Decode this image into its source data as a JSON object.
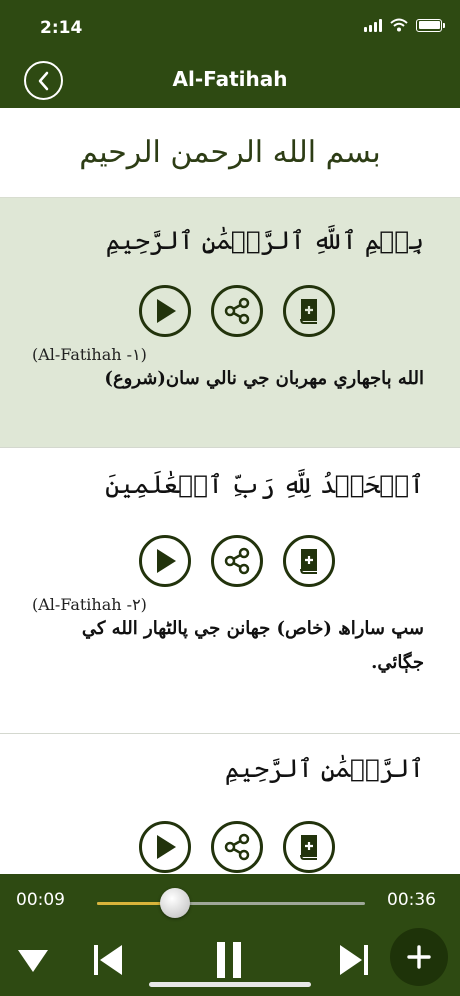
{
  "status": {
    "time": "2:14"
  },
  "header": {
    "title": "Al-Fatihah"
  },
  "bismillah_banner": {
    "text": "بسم الله الرحمن الرحيم"
  },
  "verses": [
    {
      "arabic": "بِسۡمِ ٱللَّهِ ٱلرَّحۡمَٰنِ ٱلرَّحِيمِ",
      "reference": "(Al-Fatihah -١)",
      "translation": "الله ٻاجھاري مھربان جي نالي سان(شروع)",
      "highlighted": true
    },
    {
      "arabic": "ٱلۡحَمۡدُ لِلَّهِ رَبِّ ٱلۡعَٰلَمِينَ",
      "reference": "(Al-Fatihah -٢)",
      "translation_line1": "سڀ ساراھ (خاص) جھانن جي پالڻھار الله کي",
      "translation_line2": "جڳائي.",
      "highlighted": false
    },
    {
      "arabic": "ٱلرَّحۡمَٰنِ ٱلرَّحِيمِ",
      "highlighted": false
    }
  ],
  "player": {
    "current_time": "00:09",
    "total_time": "00:36",
    "progress": 0.29,
    "accent_color": "#d9b43b"
  },
  "icons": [
    "back-chevron-icon",
    "play-icon",
    "share-icon",
    "quran-book-icon",
    "down-arrow-icon",
    "previous-icon",
    "pause-icon",
    "next-icon",
    "plus-icon"
  ],
  "colors": {
    "header_bg": "#2e4a12",
    "highlight_bg": "#dfe7d6",
    "icon_stroke": "#22330c"
  }
}
